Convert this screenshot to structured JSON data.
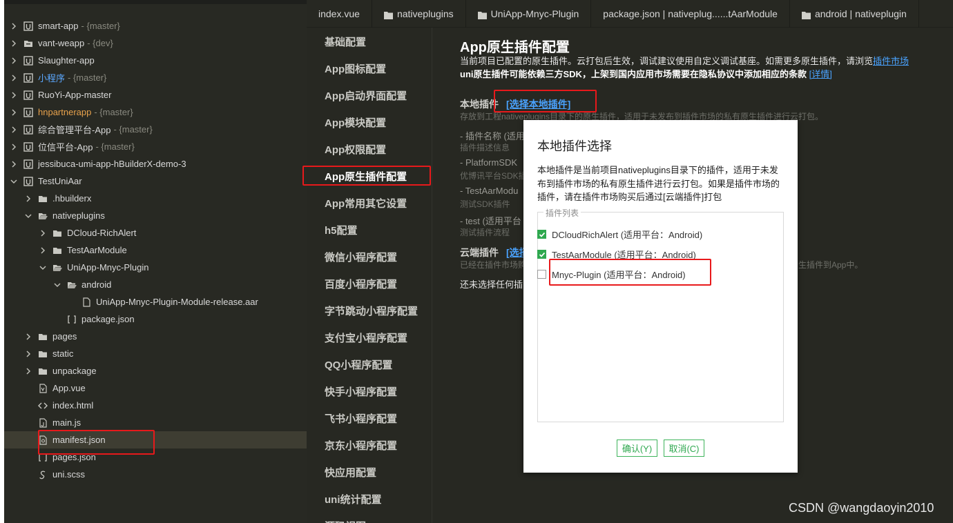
{
  "explorer": {
    "items": [
      {
        "label": "smart-app",
        "branch": "- {master}",
        "chevron": "right",
        "icon": "project-icon"
      },
      {
        "label": "vant-weapp",
        "branch": "- {dev}",
        "chevron": "right",
        "icon": "project-folder-icon"
      },
      {
        "label": "Slaughter-app",
        "branch": "",
        "chevron": "right",
        "icon": "project-icon"
      },
      {
        "label": "小程序",
        "branch": "- {master}",
        "chevron": "right",
        "icon": "project-icon",
        "color": "blue"
      },
      {
        "label": "RuoYi-App-master",
        "branch": "",
        "chevron": "right",
        "icon": "project-icon"
      },
      {
        "label": "hnpartnerapp",
        "branch": "- {master}",
        "chevron": "right",
        "icon": "project-icon",
        "color": "orange"
      },
      {
        "label": "综合管理平台-App",
        "branch": "- {master}",
        "chevron": "right",
        "icon": "project-icon"
      },
      {
        "label": "位信平台-App",
        "branch": "- {master}",
        "chevron": "right",
        "icon": "project-icon"
      },
      {
        "label": "jessibuca-umi-app-hBuilderX-demo-3",
        "branch": "",
        "chevron": "right",
        "icon": "project-icon"
      },
      {
        "label": "TestUniAar",
        "branch": "",
        "chevron": "down",
        "icon": "project-icon"
      },
      {
        "label": ".hbuilderx",
        "branch": "",
        "chevron": "right",
        "icon": "folder-icon",
        "indent": 1
      },
      {
        "label": "nativeplugins",
        "branch": "",
        "chevron": "down",
        "icon": "folder-open-icon",
        "indent": 1
      },
      {
        "label": "DCloud-RichAlert",
        "branch": "",
        "chevron": "right",
        "icon": "folder-icon",
        "indent": 2
      },
      {
        "label": "TestAarModule",
        "branch": "",
        "chevron": "right",
        "icon": "folder-icon",
        "indent": 2
      },
      {
        "label": "UniApp-Mnyc-Plugin",
        "branch": "",
        "chevron": "down",
        "icon": "folder-open-icon",
        "indent": 2
      },
      {
        "label": "android",
        "branch": "",
        "chevron": "down",
        "icon": "folder-open-icon",
        "indent": 3
      },
      {
        "label": "UniApp-Mnyc-Plugin-Module-release.aar",
        "branch": "",
        "chevron": "none",
        "icon": "file-icon",
        "indent": 4
      },
      {
        "label": "package.json",
        "branch": "",
        "chevron": "none",
        "icon": "json-icon",
        "indent": 3
      },
      {
        "label": "pages",
        "branch": "",
        "chevron": "right",
        "icon": "folder-icon",
        "indent": 1
      },
      {
        "label": "static",
        "branch": "",
        "chevron": "right",
        "icon": "folder-icon",
        "indent": 1
      },
      {
        "label": "unpackage",
        "branch": "",
        "chevron": "right",
        "icon": "folder-icon",
        "indent": 1
      },
      {
        "label": "App.vue",
        "branch": "",
        "chevron": "none",
        "icon": "vue-file-icon",
        "indent": 1
      },
      {
        "label": "index.html",
        "branch": "",
        "chevron": "none",
        "icon": "html-file-icon",
        "indent": 1
      },
      {
        "label": "main.js",
        "branch": "",
        "chevron": "none",
        "icon": "js-file-icon",
        "indent": 1
      },
      {
        "label": "manifest.json",
        "branch": "",
        "chevron": "none",
        "icon": "manifest-file-icon",
        "indent": 1,
        "selected": true
      },
      {
        "label": "pages.json",
        "branch": "",
        "chevron": "none",
        "icon": "json-icon",
        "indent": 1
      },
      {
        "label": "uni.scss",
        "branch": "",
        "chevron": "none",
        "icon": "scss-file-icon",
        "indent": 1
      }
    ]
  },
  "tabs": [
    {
      "label": "index.vue",
      "folder": false
    },
    {
      "label": "nativeplugins",
      "folder": true
    },
    {
      "label": "UniApp-Mnyc-Plugin",
      "folder": true
    },
    {
      "label": "package.json | nativeplug......tAarModule",
      "folder": false
    },
    {
      "label": "android | nativeplugin",
      "folder": true
    }
  ],
  "settings_nav": {
    "items": [
      "基础配置",
      "App图标配置",
      "App启动界面配置",
      "App模块配置",
      "App权限配置",
      "App原生插件配置",
      "App常用其它设置",
      "h5配置",
      "微信小程序配置",
      "百度小程序配置",
      "字节跳动小程序配置",
      "支付宝小程序配置",
      "QQ小程序配置",
      "快手小程序配置",
      "飞书小程序配置",
      "京东小程序配置",
      "快应用配置",
      "uni统计配置",
      "源码视图"
    ],
    "active_index": 5
  },
  "content": {
    "title": "App原生插件配置",
    "desc1": "当前项目已配置的原生插件。云打包后生效，调试建议使用自定义调试基座。如需更多原生插件，请浏览",
    "desc1_link": "插件市场",
    "desc2": "uni原生插件可能依赖三方SDK，上架到国内应用市场需要在隐私协议中添加相应的条款",
    "desc2_link": "[详情]",
    "local_title": "本地插件",
    "local_link": "[选择本地插件]",
    "local_desc": "存放到工程nativeplugins目录下的原生插件，适用于未发布到插件市场的私有原生插件进行云打包。",
    "plugins": [
      {
        "name": "- 插件名称 (适用",
        "desc": "插件描述信息"
      },
      {
        "name": "- PlatformSDK",
        "desc": "优博讯平台SDK插"
      },
      {
        "name": "- TestAarModu",
        "desc": "测试SDK插件"
      },
      {
        "name": "- test (适用平台",
        "desc": "测试插件流程"
      }
    ],
    "cloud_title": "云端插件",
    "cloud_link": "[选择",
    "cloud_desc": "已经在插件市场购",
    "cloud_desc_tail": "生插件到App中。",
    "none_selected": "还未选择任何插"
  },
  "modal": {
    "title": "本地插件选择",
    "desc_lines": [
      "本地插件是当前项目nativeplugins目录下的插件，适用于未发",
      "布到插件市场的私有原生插件进行云打包。如果是插件市场的",
      "插件，请在插件市场购买后通过[云端插件]打包"
    ],
    "legend": "插件列表",
    "plugins": [
      {
        "label": "DCloudRichAlert (适用平台：Android)",
        "checked": true
      },
      {
        "label": "TestAarModule (适用平台：Android)",
        "checked": true
      },
      {
        "label": "Mnyc-Plugin (适用平台：Android)",
        "checked": false
      }
    ],
    "confirm": "确认(Y)",
    "cancel": "取消(C)"
  },
  "watermark": "CSDN @wangdaoyin2010",
  "colors": {
    "highlight": "#e8191b",
    "link": "#4aa3ff",
    "check": "#2fa84f"
  }
}
